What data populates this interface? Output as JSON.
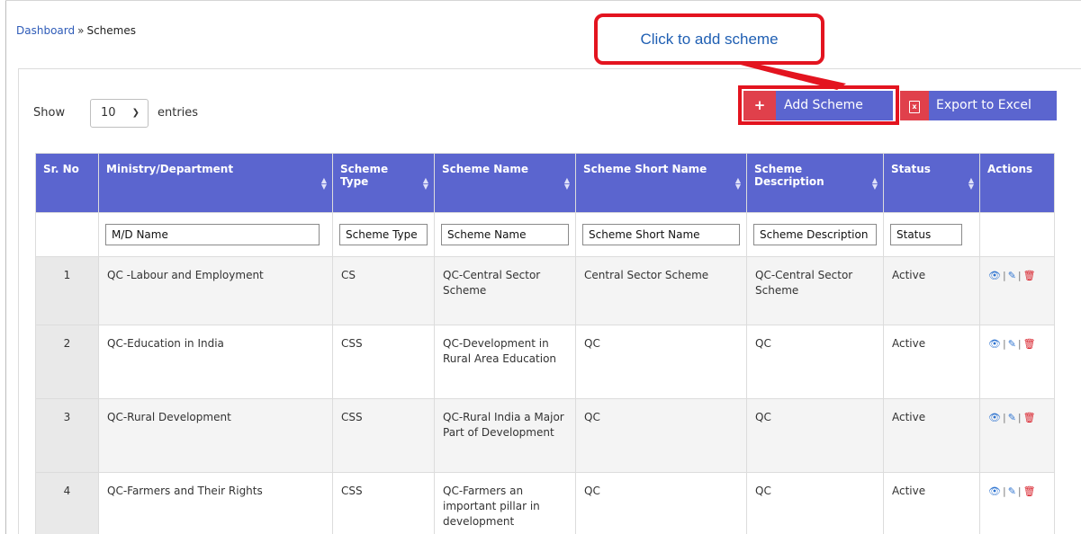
{
  "breadcrumb": {
    "home": "Dashboard",
    "separator": "»",
    "current": "Schemes"
  },
  "callout": {
    "text": "Click to add scheme",
    "color": "#e3141f"
  },
  "length_menu": {
    "show": "Show",
    "value": "10",
    "suffix": "entries"
  },
  "buttons": {
    "add": {
      "icon": "+",
      "label": "Add Scheme"
    },
    "export": {
      "icon": "excel-icon",
      "label": "Export to Excel"
    }
  },
  "colors": {
    "header": "#5b65cf",
    "accent": "#e0404b",
    "highlight": "#e3141f"
  },
  "table": {
    "columns": [
      "Sr. No",
      "Ministry/Department",
      "Scheme Type",
      "Scheme Name",
      "Scheme Short Name",
      "Scheme Description",
      "Status",
      "Actions"
    ],
    "filters": {
      "ministry": "M/D Name",
      "type": "Scheme Type",
      "name": "Scheme Name",
      "short": "Scheme Short Name",
      "desc": "Scheme Description",
      "status": "Status"
    },
    "rows": [
      {
        "sr": "1",
        "ministry": "QC -Labour and Employment",
        "type": "CS",
        "name": "QC-Central Sector Scheme",
        "short": "Central Sector Scheme",
        "desc": "QC-Central Sector Scheme",
        "status": "Active"
      },
      {
        "sr": "2",
        "ministry": "QC-Education in India",
        "type": "CSS",
        "name": "QC-Development in Rural Area Education",
        "short": "QC",
        "desc": "QC",
        "status": "Active"
      },
      {
        "sr": "3",
        "ministry": "QC-Rural Development",
        "type": "CSS",
        "name": "QC-Rural India a Major Part of Development",
        "short": "QC",
        "desc": "QC",
        "status": "Active"
      },
      {
        "sr": "4",
        "ministry": "QC-Farmers and Their Rights",
        "type": "CSS",
        "name": "QC-Farmers an important pillar in development",
        "short": "QC",
        "desc": "QC",
        "status": "Active"
      }
    ],
    "action_icons": [
      "eye-icon",
      "edit-icon",
      "trash-icon"
    ],
    "action_separator": "|"
  }
}
